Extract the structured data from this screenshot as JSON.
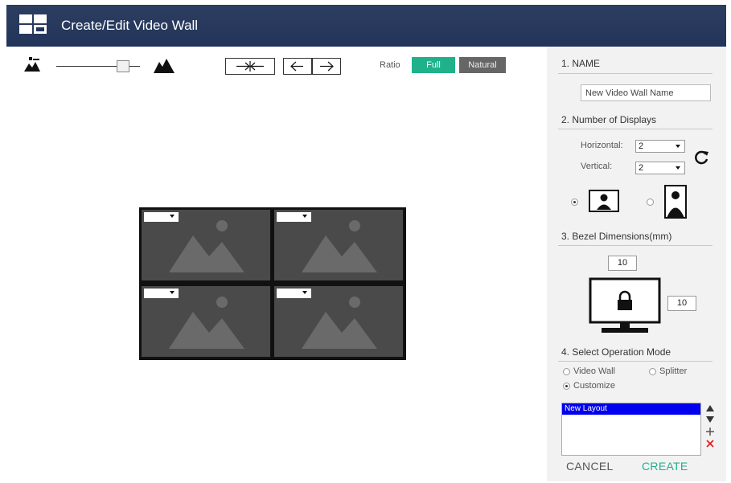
{
  "app": {
    "title": "Create/Edit Video Wall"
  },
  "colors": {
    "header_bg": "#23345a",
    "accent_green": "#1fb28a",
    "selection_blue": "#0000ee",
    "cell_gray": "#4a4a4a"
  },
  "toolbar": {
    "zoom_out_icon": "mountains-small-icon",
    "zoom_in_icon": "mountains-large-icon",
    "ratio_label": "Ratio",
    "ratio_full": "Full",
    "ratio_natural": "Natural"
  },
  "wall": {
    "rows": 2,
    "cols": 2
  },
  "panel": {
    "name": {
      "title": "1. NAME",
      "value": "New Video Wall Name"
    },
    "displays": {
      "title": "2. Number of Displays",
      "horizontal_label": "Horizontal:",
      "horizontal_value": "2",
      "vertical_label": "Vertical:",
      "vertical_value": "2"
    },
    "bezel": {
      "title": "3. Bezel Dimensions(mm)",
      "top_value": "10",
      "side_value": "10"
    },
    "mode": {
      "title": "4. Select Operation Mode",
      "video_wall": "Video Wall",
      "splitter": "Splitter",
      "customize": "Customize"
    },
    "layouts": {
      "items": [
        "New Layout"
      ]
    },
    "cancel": "CANCEL",
    "create": "CREATE"
  }
}
